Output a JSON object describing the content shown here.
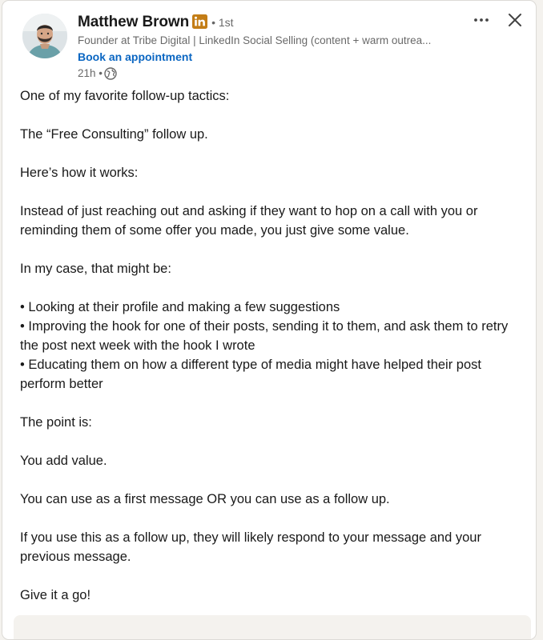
{
  "author": {
    "name": "Matthew Brown",
    "degree": "• 1st",
    "headline": "Founder at Tribe Digital | LinkedIn Social Selling (content + warm outrea...",
    "cta": "Book an appointment",
    "time": "21h •"
  },
  "icons": {
    "avatar": "profile-photo",
    "badge": "linkedin-premium-icon",
    "visibility": "globe-icon",
    "more": "more-horizontal-icon",
    "close": "close-icon"
  },
  "colors": {
    "accent": "#0a66c2",
    "premium_badge": "#c37d16",
    "text_primary": "#191919",
    "text_secondary": "#666666"
  },
  "post": {
    "p1": "One of my favorite follow-up tactics:",
    "p2": "The “Free Consulting” follow up.",
    "p3": "Here’s how it works:",
    "p4": "Instead of just reaching out and asking if they want to hop on a call with you or reminding them of some offer you made, you just give some value.",
    "p5": "In my case, that might be:",
    "bullets": [
      "• Looking at their profile and making a few suggestions",
      "• Improving the hook for one of their posts, sending it to them, and ask them to retry the post next week with the hook I wrote",
      "• Educating them on how a different type of media might have helped their post perform better"
    ],
    "p6": "The point is:",
    "p7": "You add value.",
    "p8": "You can use as a first message OR you can use as a follow up.",
    "p9": "If you use this as a follow up, they will likely respond to your message and your previous message.",
    "p10": "Give it a go!"
  }
}
